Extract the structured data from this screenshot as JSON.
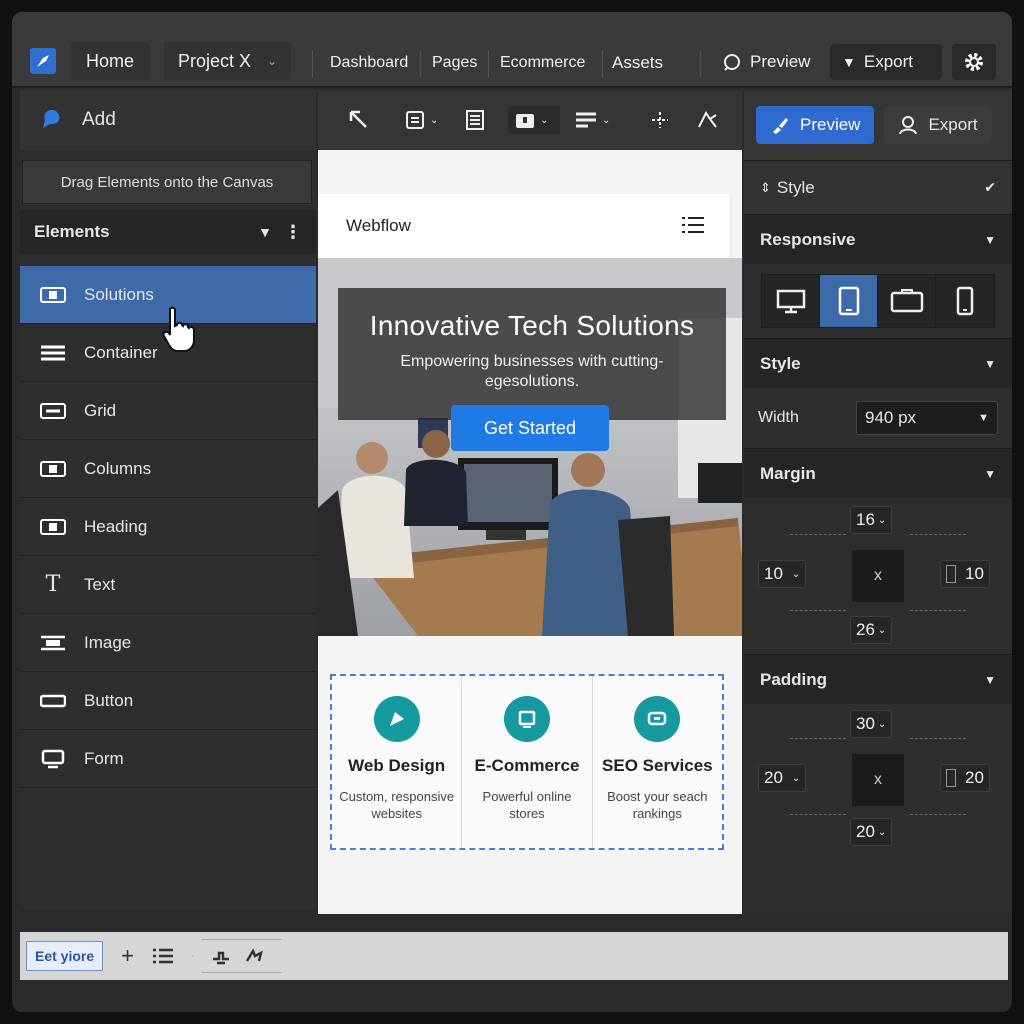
{
  "topbar": {
    "home": "Home",
    "project": "Project X",
    "nav": [
      "Dashboard",
      "Pages",
      "Ecommerce",
      "Assets"
    ],
    "preview": "Preview",
    "export": "Export"
  },
  "left": {
    "add": "Add",
    "drag_hint": "Drag Elements onto the Canvas",
    "elements_title": "Elements",
    "items": [
      {
        "label": "Solutions",
        "icon": "section-icon"
      },
      {
        "label": "Container",
        "icon": "container-icon"
      },
      {
        "label": "Grid",
        "icon": "grid-icon"
      },
      {
        "label": "Columns",
        "icon": "columns-icon"
      },
      {
        "label": "Heading",
        "icon": "heading-icon"
      },
      {
        "label": "Text",
        "icon": "text-icon"
      },
      {
        "label": "Image",
        "icon": "image-icon"
      },
      {
        "label": "Button",
        "icon": "button-icon"
      },
      {
        "label": "Form",
        "icon": "form-icon"
      }
    ]
  },
  "canvas": {
    "site_name": "Webflow",
    "hero_title": "Innovative Tech Solutions",
    "hero_sub_1": "Empowering businesses with cutting-",
    "hero_sub_2": "egesolutions.",
    "cta": "Get Started",
    "services": [
      {
        "title": "Web Design",
        "desc": "Custom, responsive websites"
      },
      {
        "title": "E-Commerce",
        "desc": "Powerful online stores"
      },
      {
        "title": "SEO Services",
        "desc": "Boost your seach rankings"
      }
    ]
  },
  "right": {
    "preview": "Preview",
    "export": "Export",
    "style_top": "Style",
    "responsive": "Responsive",
    "style": "Style",
    "width_label": "Width",
    "width_value": "940 px",
    "margin": "Margin",
    "margin_top": "16",
    "margin_left": "10",
    "margin_right": "10",
    "margin_bottom": "26",
    "padding": "Padding",
    "padding_top": "30",
    "padding_left": "20",
    "padding_right": "20",
    "padding_bottom": "20",
    "center_label": "x"
  },
  "bottom": {
    "label": "Eet yiore"
  },
  "colors": {
    "accent": "#3d6aa8",
    "cta": "#1f7ae6",
    "service_icon": "#159aa0",
    "selection_dash": "#4a7fd0"
  }
}
